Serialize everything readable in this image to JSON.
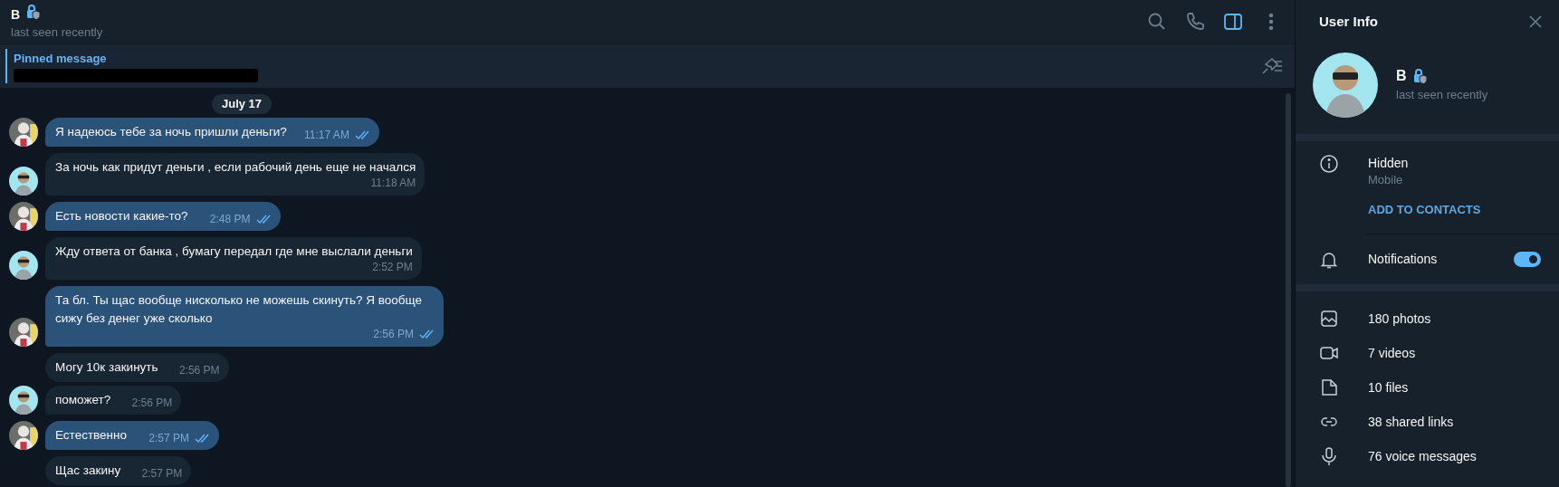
{
  "chat_header": {
    "name": "B",
    "status": "last seen recently",
    "info_panel_open": true
  },
  "pinned": {
    "title": "Pinned message"
  },
  "date": "July 17",
  "messages": [
    {
      "kind": "outgoing",
      "text": "Я надеюсь тебе за ночь пришли деньги?",
      "time": "11:17 AM",
      "avatar": true
    },
    {
      "kind": "incoming",
      "text": "За ночь как придут деньги , если рабочий день еще не начался",
      "time": "11:18 AM",
      "avatar": true
    },
    {
      "kind": "outgoing",
      "text": "Есть новости какие-то?",
      "time": "2:48 PM",
      "avatar": true
    },
    {
      "kind": "incoming",
      "text": "Жду ответа от банка , бумагу передал где мне выслали деньги",
      "time": "2:52 PM",
      "avatar": true
    },
    {
      "kind": "outgoing",
      "text": "Та бл. Ты щас вообще нисколько не можешь скинуть? Я вообще сижу без денег уже сколько",
      "time": "2:56 PM",
      "avatar": true
    },
    {
      "kind": "incoming",
      "text": "Могу 10к закинуть",
      "time": "2:56 PM",
      "avatar": false
    },
    {
      "kind": "incoming",
      "text": "поможет?",
      "time": "2:56 PM",
      "avatar": true
    },
    {
      "kind": "outgoing",
      "text": "Естественно",
      "time": "2:57 PM",
      "avatar": true
    },
    {
      "kind": "incoming",
      "text": "Щас закину",
      "time": "2:57 PM",
      "avatar": false
    }
  ],
  "user_info": {
    "title": "User Info",
    "name": "B",
    "status": "last seen recently",
    "phone": "Hidden",
    "phone_label": "Mobile",
    "add_contact": "ADD TO CONTACTS",
    "notifications": {
      "label": "Notifications",
      "on": true
    },
    "media": [
      {
        "kind": "photos",
        "label": "180 photos"
      },
      {
        "kind": "videos",
        "label": "7 videos"
      },
      {
        "kind": "files",
        "label": "10 files"
      },
      {
        "kind": "links",
        "label": "38 shared links"
      },
      {
        "kind": "voice",
        "label": "76 voice messages"
      }
    ]
  }
}
